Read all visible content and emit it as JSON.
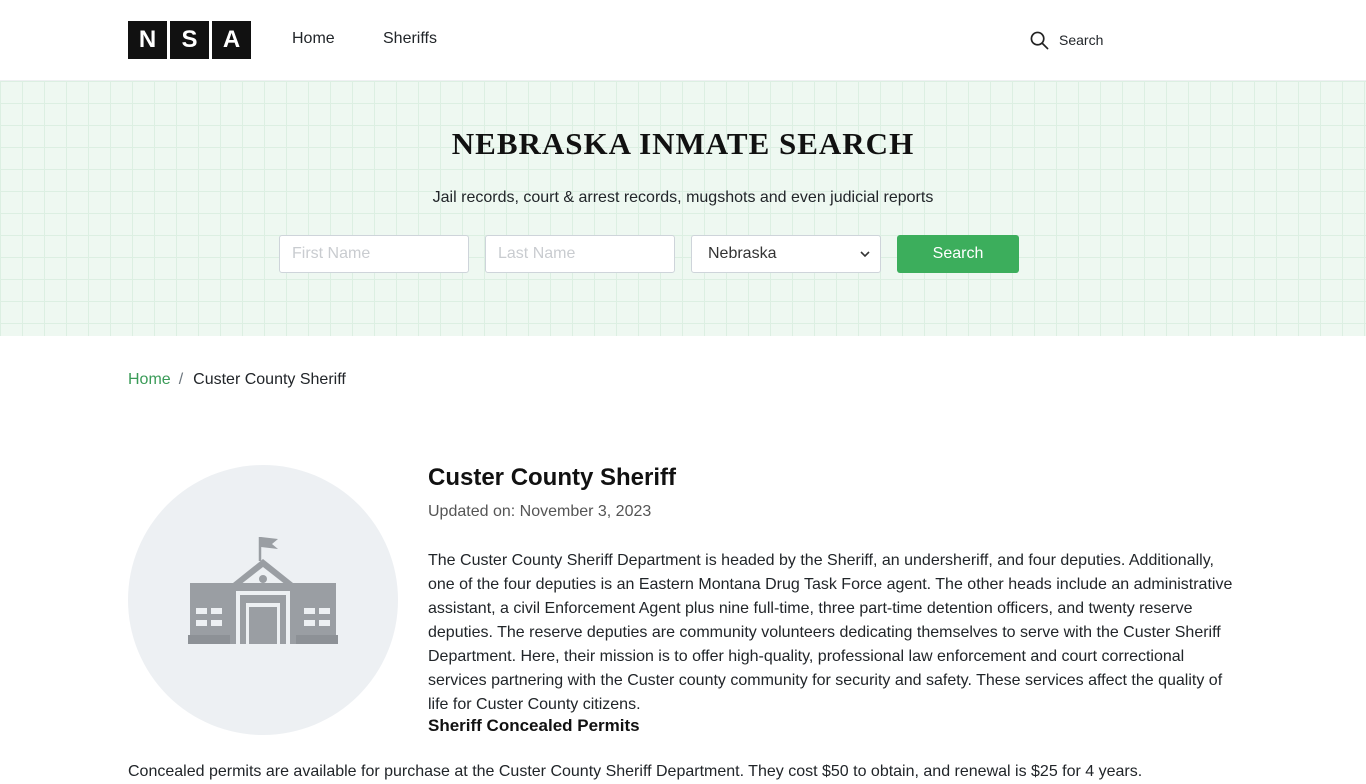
{
  "header": {
    "logo_letters": [
      "N",
      "S",
      "A"
    ],
    "nav": [
      {
        "label": "Home"
      },
      {
        "label": "Sheriffs"
      }
    ],
    "search_label": "Search"
  },
  "hero": {
    "title": "NEBRASKA INMATE SEARCH",
    "subtitle": "Jail records, court & arrest records, mugshots and even judicial reports",
    "first_name_placeholder": "First Name",
    "last_name_placeholder": "Last Name",
    "state_selected": "Nebraska",
    "search_button": "Search"
  },
  "breadcrumb": {
    "home": "Home",
    "separator": "/",
    "current": "Custer County Sheriff"
  },
  "content": {
    "title": "Custer County Sheriff",
    "updated_label": "Updated on:",
    "updated_date": "November 3, 2023",
    "description": "The Custer County Sheriff Department is headed by the Sheriff, an undersheriff, and four deputies. Additionally, one of the four deputies is an Eastern Montana Drug Task Force agent. The other heads include an administrative assistant, a civil Enforcement Agent plus nine full-time, three part-time detention officers, and twenty reserve deputies. The reserve deputies are community volunteers dedicating themselves to serve with the Custer Sheriff Department. Here, their mission is to offer high-quality, professional law enforcement and court correctional services partnering with the Custer county community for security and safety. These services affect the quality of life for Custer County citizens.",
    "subheading": "Sheriff Concealed Permits",
    "next_paragraph_partial": "Concealed permits are available for purchase at the Custer County Sheriff Department. They cost $50 to obtain, and renewal is $25 for 4 years."
  },
  "colors": {
    "accent": "#3cae5c",
    "link": "#3a9b58",
    "hero_bg": "#eef8f1",
    "icon_gray": "#9a9ea3"
  },
  "icons": {
    "search": "search-icon",
    "building": "courthouse-icon",
    "select_caret": "chevron-down-icon"
  }
}
